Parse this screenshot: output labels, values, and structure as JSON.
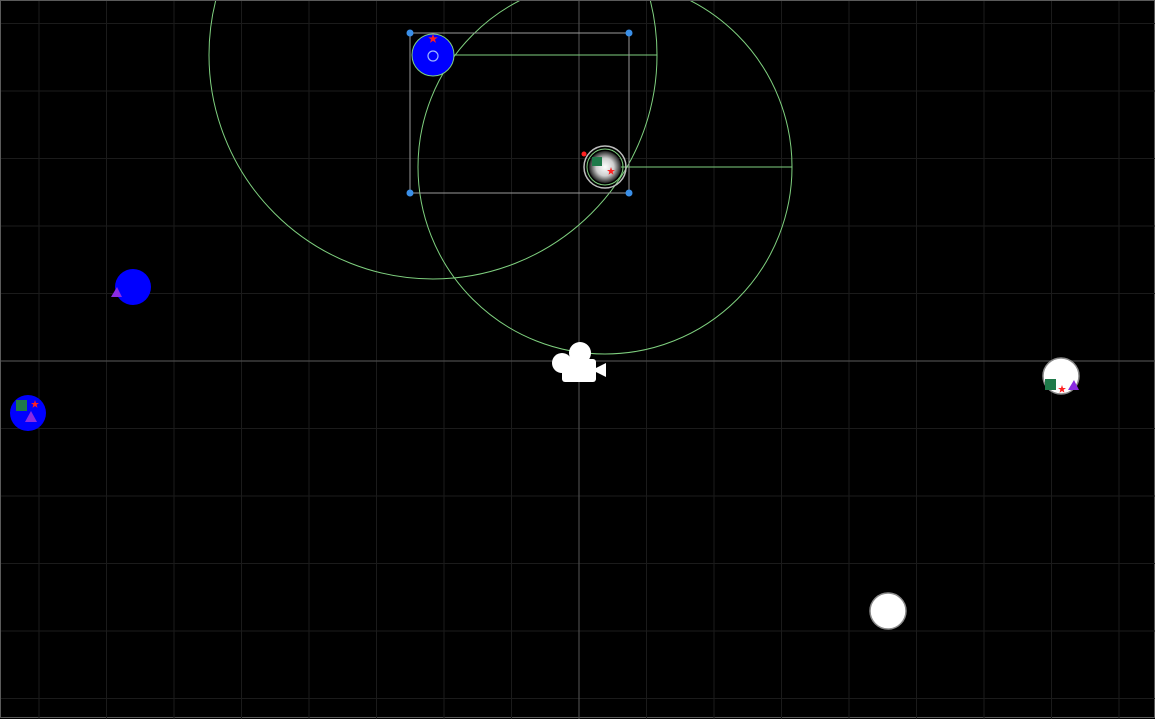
{
  "scene": {
    "colors": {
      "background": "#000000",
      "grid_minor": "#1b1b1b",
      "grid_major": "#3c3c3c",
      "gizmo_green": "#7fd07f",
      "selection_frame": "#9a9a9a",
      "handle_blue": "#3a8fe8",
      "blue_body": "#0000ff",
      "white_body": "#ffffff",
      "marker_square": "#1f7a4a",
      "marker_star": "#ff2020",
      "marker_triangle": "#8a2be2"
    },
    "icons": {
      "camera": "camera-icon",
      "move_handle": "move-handle-icon",
      "resize_handle": "resize-handle-icon",
      "star": "star-icon",
      "triangle": "triangle-icon",
      "square": "square-icon"
    }
  }
}
